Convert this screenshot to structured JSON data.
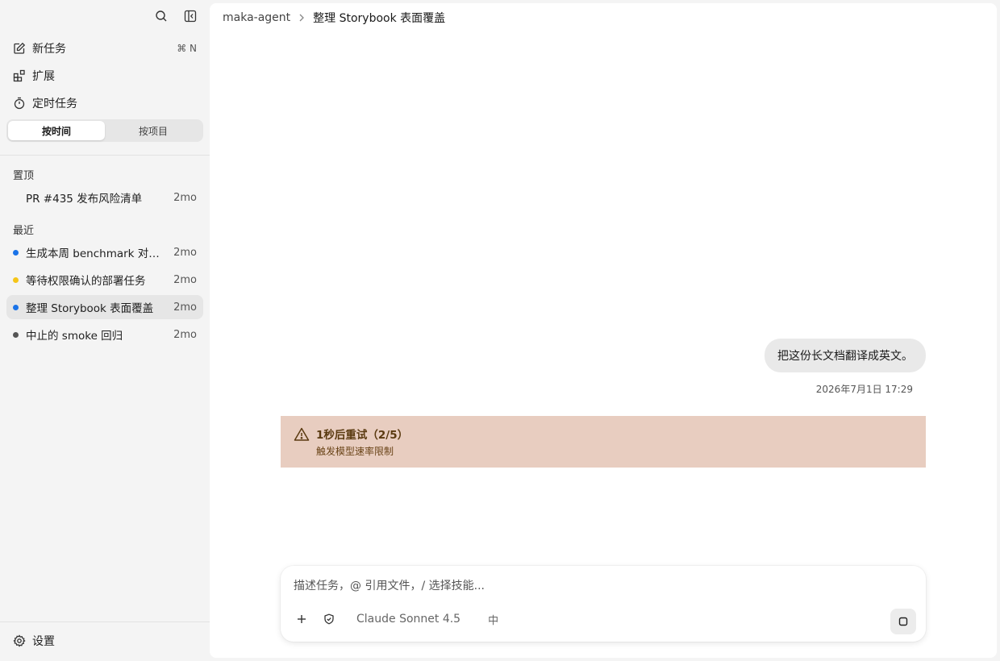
{
  "sidebar": {
    "nav": [
      {
        "label": "新任务",
        "shortcut": "⌘ N"
      },
      {
        "label": "扩展"
      },
      {
        "label": "定时任务"
      }
    ],
    "segmented": {
      "by_time": "按时间",
      "by_project": "按项目"
    },
    "pinned": {
      "label": "置顶",
      "items": [
        {
          "name": "PR #435 发布风险清单",
          "age": "2mo"
        }
      ]
    },
    "recent": {
      "label": "最近",
      "items": [
        {
          "name": "生成本周 benchmark 对比报告",
          "age": "2mo",
          "color": "#1a73e8"
        },
        {
          "name": "等待权限确认的部署任务",
          "age": "2mo",
          "color": "#f5c518"
        },
        {
          "name": "整理 Storybook 表面覆盖",
          "age": "2mo",
          "color": "#1a73e8"
        },
        {
          "name": "中止的 smoke 回归",
          "age": "2mo",
          "color": "#555555"
        }
      ]
    },
    "settings_label": "设置"
  },
  "breadcrumb": {
    "root": "maka-agent",
    "current": "整理 Storybook 表面覆盖"
  },
  "conversation": {
    "user_message": "把这份长文档翻译成英文。",
    "timestamp": "2026年7月1日 17:29",
    "alert": {
      "title": "1秒后重试（2/5）",
      "subtitle": "触发模型速率限制"
    }
  },
  "composer": {
    "placeholder": "描述任务，@ 引用文件，/ 选择技能...",
    "value": "",
    "model": "Claude Sonnet 4.5",
    "lang": "中"
  }
}
